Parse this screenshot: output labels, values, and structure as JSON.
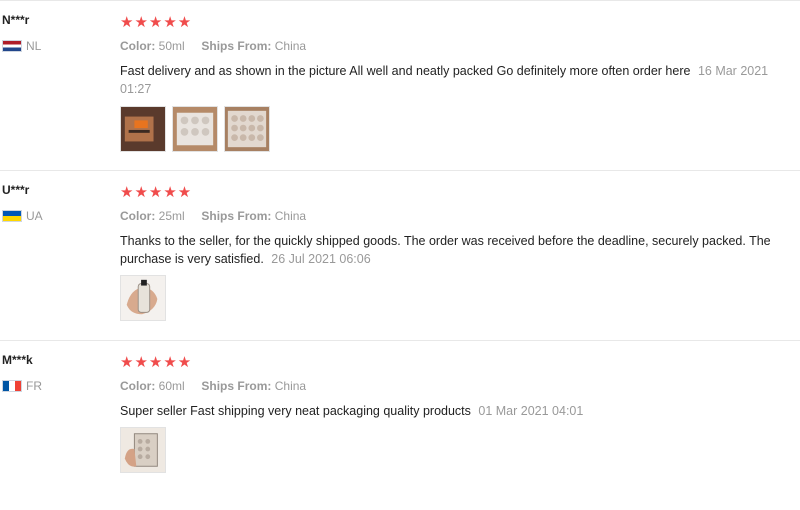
{
  "reviews": [
    {
      "user": "N***r",
      "country": "NL",
      "flag_icon": "netherlands-flag-icon",
      "stars": "★★★★★",
      "rating": 5,
      "color_label": "Color:",
      "color_value": "50ml",
      "ships_label": "Ships From:",
      "ships_value": "China",
      "text": "Fast delivery and as shown in the picture All well and neatly packed Go definitely more often order here",
      "date": "16 Mar 2021 01:27",
      "photo_count": 3
    },
    {
      "user": "U***r",
      "country": "UA",
      "flag_icon": "ukraine-flag-icon",
      "stars": "★★★★★",
      "rating": 5,
      "color_label": "Color:",
      "color_value": "25ml",
      "ships_label": "Ships From:",
      "ships_value": "China",
      "text": "Thanks to the seller, for the quickly shipped goods. The order was received before the deadline, securely packed. The purchase is very satisfied.",
      "date": "26 Jul 2021 06:06",
      "photo_count": 1
    },
    {
      "user": "M***k",
      "country": "FR",
      "flag_icon": "france-flag-icon",
      "stars": "★★★★★",
      "rating": 5,
      "color_label": "Color:",
      "color_value": "60ml",
      "ships_label": "Ships From:",
      "ships_value": "China",
      "text": "Super seller Fast shipping very neat packaging quality products",
      "date": "01 Mar 2021 04:01",
      "photo_count": 1
    }
  ],
  "colors": {
    "star": "#f04c4c",
    "muted": "#999999",
    "text": "#222222",
    "divider": "#e8e8e8"
  }
}
